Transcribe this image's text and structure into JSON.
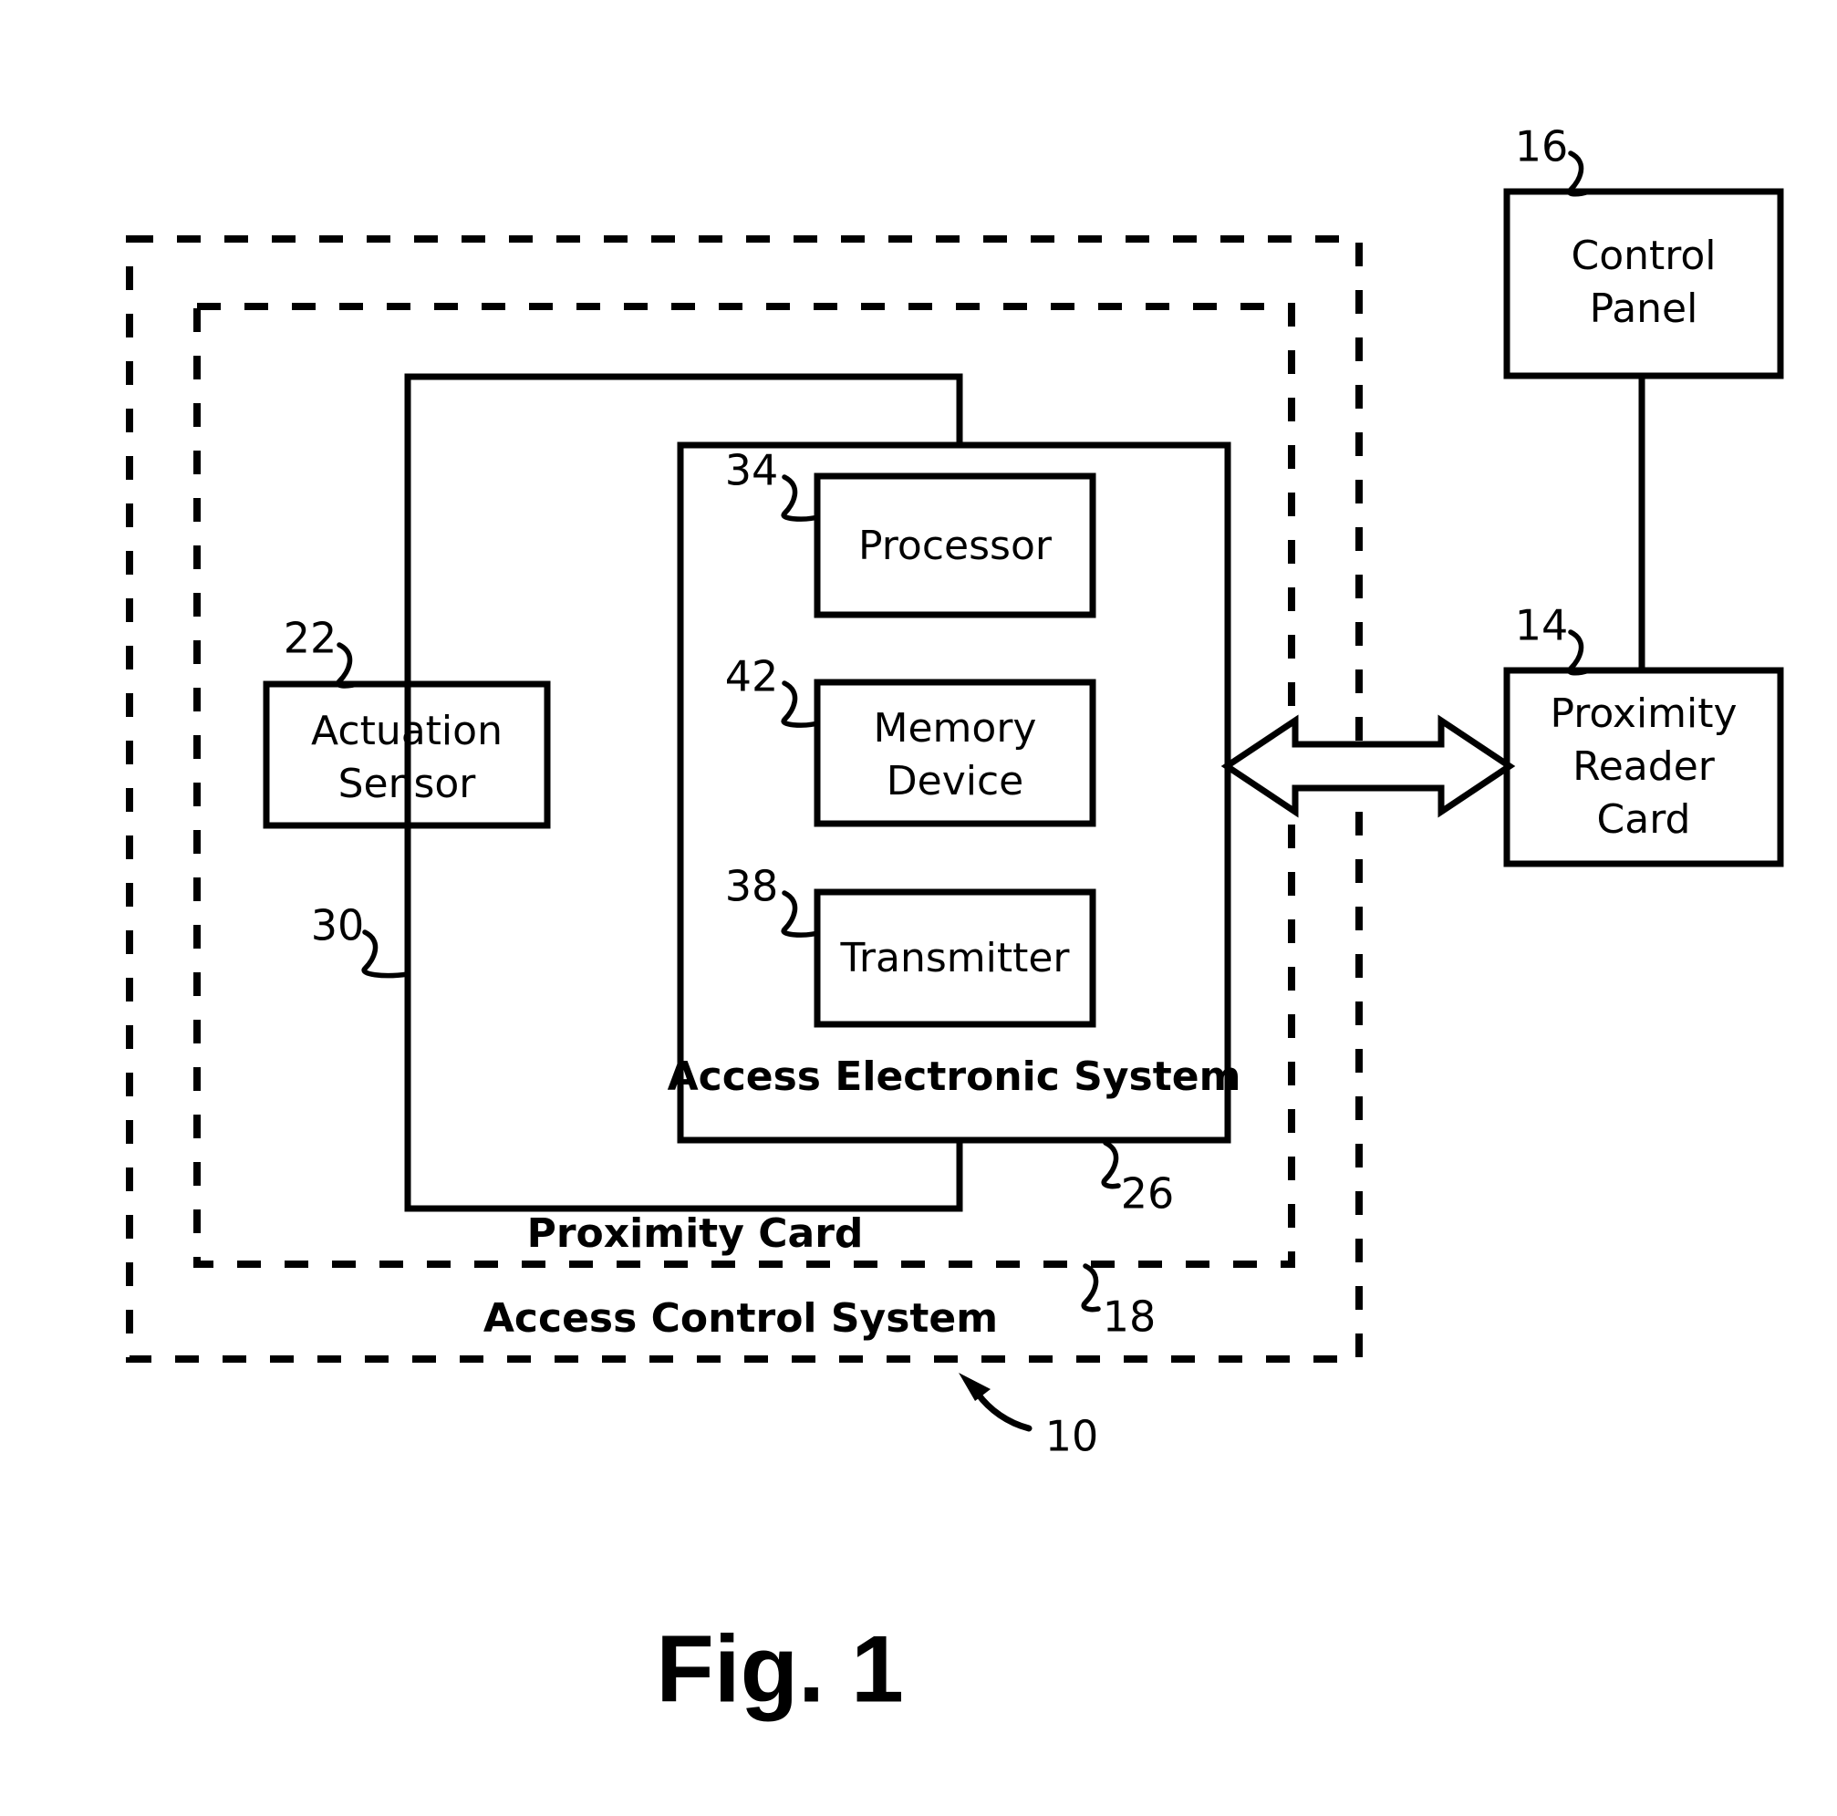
{
  "figure": {
    "caption": "Fig. 1",
    "type": "patent-block-diagram"
  },
  "boundaries": [
    {
      "id": "access-control-system",
      "label": "Access Control System",
      "reference": "18",
      "style": "dashed"
    },
    {
      "id": "proximity-card",
      "label": "Proximity Card",
      "reference": "10",
      "style": "dashed"
    }
  ],
  "blocks": {
    "control_panel": {
      "label_line1": "Control",
      "label_line2": "Panel",
      "reference": "16"
    },
    "proximity_reader_card": {
      "label_line1": "Proximity",
      "label_line2": "Reader",
      "label_line3": "Card",
      "reference": "14"
    },
    "actuation_sensor": {
      "label_line1": "Actuation",
      "label_line2": "Sensor",
      "reference": "22"
    },
    "access_electronic_system": {
      "label": "Access Electronic System",
      "reference": "26"
    },
    "processor": {
      "label": "Processor",
      "reference": "34"
    },
    "memory_device": {
      "label_line1": "Memory",
      "label_line2": "Device",
      "reference": "42"
    },
    "transmitter": {
      "label": "Transmitter",
      "reference": "38"
    }
  },
  "connections": {
    "sensor_bus": {
      "reference": "30"
    }
  },
  "group_labels": {
    "proximity_card": "Proximity Card",
    "access_control_system": "Access Control System",
    "proximity_card_reference": "10",
    "access_control_system_reference": "18"
  },
  "colors": {
    "stroke": "#000000",
    "background": "#ffffff",
    "fill": "#ffffff"
  }
}
